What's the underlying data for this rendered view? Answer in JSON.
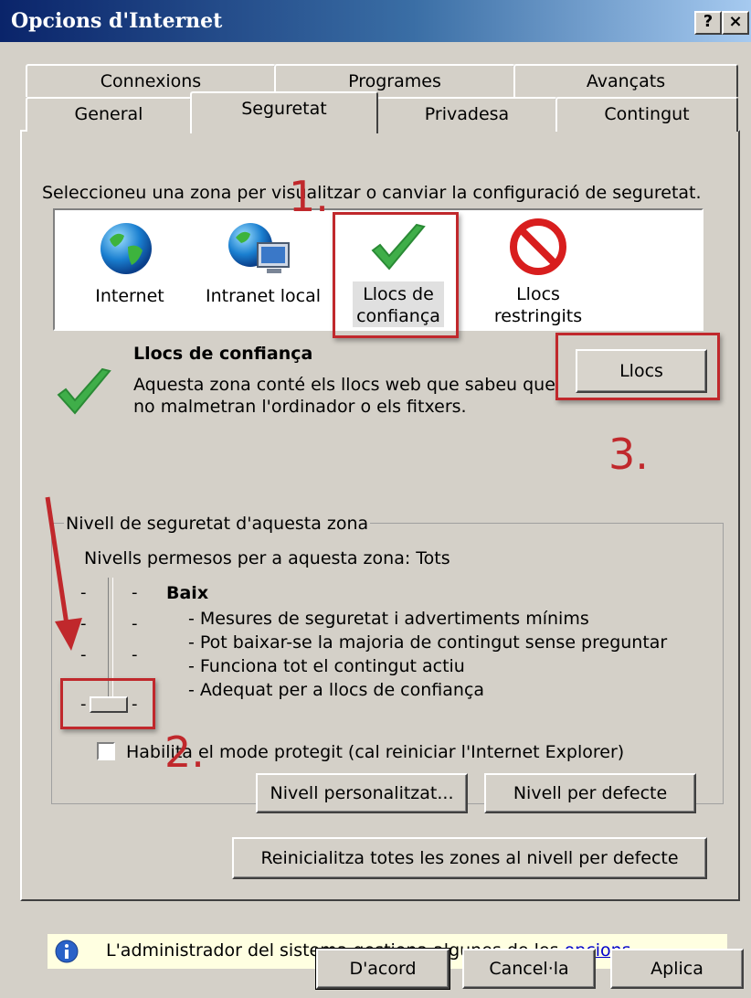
{
  "window": {
    "title": "Opcions d'Internet",
    "help_button": "?",
    "close_button": "×"
  },
  "tabs": {
    "row1": [
      "Connexions",
      "Programes",
      "Avançats"
    ],
    "row2": [
      "General",
      "Seguretat",
      "Privadesa",
      "Contingut"
    ],
    "active": "Seguretat"
  },
  "security": {
    "instruction": "Seleccioneu una zona per visualitzar o canviar la configuració de seguretat.",
    "zones": [
      {
        "label_line1": "Internet",
        "label_line2": "",
        "icon": "globe-icon"
      },
      {
        "label_line1": "Intranet local",
        "label_line2": "",
        "icon": "intranet-icon"
      },
      {
        "label_line1": "Llocs de",
        "label_line2": "confiança",
        "icon": "checkmark-icon",
        "selected": true
      },
      {
        "label_line1": "Llocs",
        "label_line2": "restringits",
        "icon": "no-entry-icon"
      }
    ],
    "zone_title": "Llocs de confiança",
    "zone_desc_line1": "Aquesta zona conté els llocs web que sabeu que",
    "zone_desc_line2": "no malmetran l'ordinador o els fitxers.",
    "sites_button": "Llocs",
    "level_group_title": "Nivell de seguretat d'aquesta zona",
    "allowed_levels": "Nivells permesos per a aquesta zona: Tots",
    "level_name": "Baix",
    "level_bullets": [
      "- Mesures de seguretat i advertiments mínims",
      "- Pot baixar-se la majoria de contingut sense preguntar",
      "- Funciona tot el contingut actiu",
      "- Adequat per a llocs de confiança"
    ],
    "protected_mode_label": "Habilita el mode protegit (cal reiniciar l'Internet Explorer)",
    "protected_mode_checked": false,
    "custom_level_button": "Nivell personalitzat...",
    "default_level_button": "Nivell per defecte",
    "reset_all_button": "Reinicialitza totes les zones al nivell per defecte",
    "info_text": "L'administrador del sistema gestiona algunes de les ",
    "info_link": "opcions",
    "info_suffix": "."
  },
  "annotations": [
    "1.",
    "2.",
    "3."
  ],
  "footer": {
    "ok": "D'acord",
    "cancel": "Cancel·la",
    "apply": "Aplica"
  },
  "colors": {
    "annotation_red": "#c0282c",
    "title_blue": "#0a246a",
    "info_bg": "#ffffe1"
  }
}
